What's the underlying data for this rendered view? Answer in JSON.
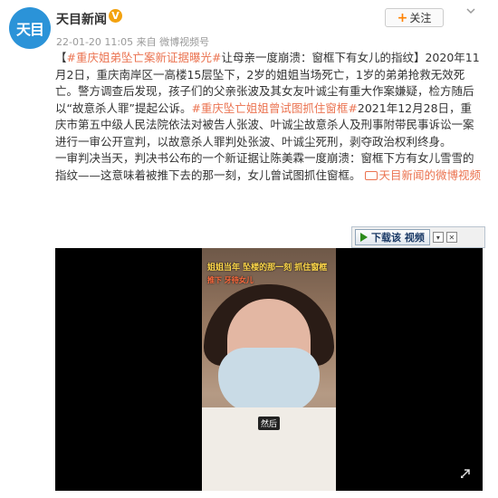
{
  "post": {
    "avatar_text": "天目",
    "author": "天目新闻",
    "verified_mark": "V",
    "follow_label": "关注",
    "timestamp": "22-01-20 11:05",
    "via_prefix": "来自",
    "source": "微博视频号",
    "hashtag1": "#重庆姐弟坠亡案新证据曝光#",
    "para1": "让母亲一度崩溃：窗框下有女儿的指纹】2020年11月2日，重庆南岸区一高楼15层坠下，2岁的姐姐当场死亡，1岁的弟弟抢救无效死亡。警方调查后发现，孩子们的父亲张波及其女友叶诚尘有重大作案嫌疑，检方随后以“故意杀人罪”提起公诉。",
    "hashtag2": "#重庆坠亡姐姐曾试图抓住窗框#",
    "para2": "2021年12月28日，重庆市第五中级人民法院依法对被告人张波、叶诚尘故意杀人及刑事附带民事诉讼一案进行一审公开宣判，以故意杀人罪判处张波、叶诚尘死刑，剥夺政治权利终身。",
    "para3": "一审判决当天，判决书公布的一个新证据让陈美霖一度崩溃：窗框下方有女儿雪雪的指纹——这意味着被推下去的那一刻，女儿曾试图抓住窗框。",
    "video_link": "天目新闻的微博视频",
    "bracket_open": "【"
  },
  "player": {
    "download_label": "下载该 视频"
  },
  "video": {
    "caption_top": "姐姐当年  坠楼的那一刻  抓住窗框",
    "caption_second": "推下 牙待女儿",
    "subtitle": "然后"
  },
  "colors": {
    "accent": "#eb7350",
    "follow_plus": "#ff8200",
    "verified": "#f3a20f",
    "avatar_bg": "#2b93d8"
  }
}
